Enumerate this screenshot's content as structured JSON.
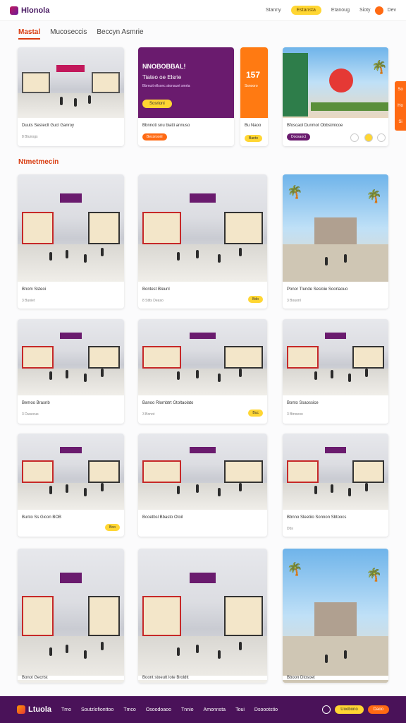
{
  "header": {
    "logo_text": "Hlonola",
    "nav": [
      "Stanny",
      "Estansta",
      "Etanoug",
      "Sioty",
      "Dev"
    ]
  },
  "tabs": [
    "Mastal",
    "Mucoseccis",
    "Beccyn Asmrie"
  ],
  "featured": {
    "card1": {
      "caption": "Duuts Sesteclt Gucl Ganroy",
      "sub": "8 Btunogs"
    },
    "promo": {
      "line1": "NNOBOBBAL!",
      "line2": "Tiateo oe Elsrie",
      "line3": "Bbrnuit ellsonc atonaunt smrta",
      "button": "Sosrioni",
      "caption": "Bbnnoti snu biatti annuso",
      "badge": "Becoroonl"
    },
    "counter": {
      "number": "157",
      "label": "Ssnooro",
      "caption": "Bu Naoo",
      "badge": "Banto"
    },
    "card4": {
      "caption": "Bfoscaol Dunmot Obbstmicoe",
      "badge": "Doosaoct"
    }
  },
  "section_title": "Ntmetmecin",
  "side_tab": [
    "So",
    "Ho",
    "Si"
  ],
  "grid": [
    {
      "caption": "Bnom Ssteoi",
      "sub": "3 Buoiet"
    },
    {
      "caption": "Bontest Bleunl",
      "sub": "8 Stlts Deaso",
      "badge": "Bdo"
    },
    {
      "caption": "Ponor Tlunde Sesloie Soorlaouo",
      "sub": "3 Bouonl"
    },
    {
      "caption": "Bemoo Brasnb",
      "sub": "3 Dusecus"
    },
    {
      "caption": "Banoo Rlombtrt Gtoltaolato",
      "sub": "3 Bonot",
      "badge": "Buc"
    },
    {
      "caption": "Bonto Ssaossice",
      "sub": "3 Btnoeoo"
    },
    {
      "caption": "Bunto Ss Gicon BOB",
      "sub": "",
      "badge": "Boo"
    },
    {
      "caption": "Bcoetbsl Bbasto Otoil",
      "sub": ""
    },
    {
      "caption": "Bbnno Sleetiio Sonnon Sbtoocs",
      "sub": "Dbs"
    },
    {
      "caption": "Bonot Gecrtst",
      "sub": ""
    },
    {
      "caption": "Boont stoeutt lote Broldtt",
      "sub": ""
    },
    {
      "caption": "Bboon Dtosoet",
      "sub": ""
    }
  ],
  "footer": {
    "logo_text": "Ltuola",
    "links": [
      "Tmo",
      "Soutzlofionttoo",
      "Tmco",
      "Osoodoaoo",
      "Tnnio",
      "Amonnsta",
      "Toui",
      "Dsoootstio"
    ],
    "btn1": "Uoobono",
    "btn2": "Daoo"
  },
  "colors": {
    "accent": "#d93b0f",
    "purple": "#4a1259",
    "yellow": "#ffd633",
    "orange": "#ff6a13"
  }
}
